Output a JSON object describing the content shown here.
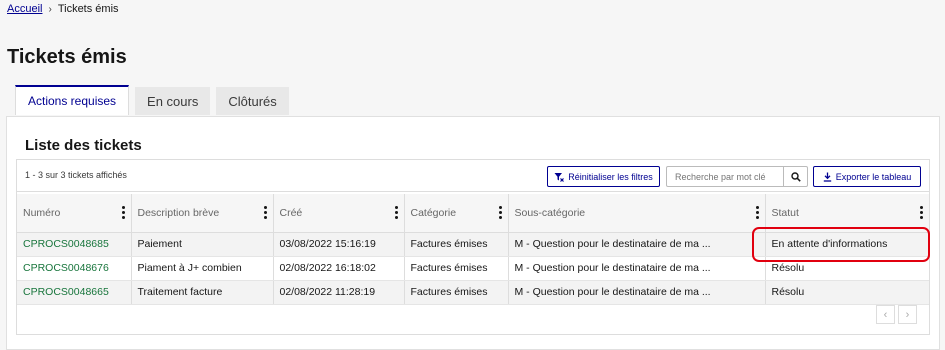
{
  "breadcrumb": {
    "home": "Accueil",
    "separator": "›",
    "current": "Tickets émis"
  },
  "page": {
    "title": "Tickets émis"
  },
  "tabs": [
    {
      "label": "Actions requises",
      "active": true
    },
    {
      "label": "En cours",
      "active": false
    },
    {
      "label": "Clôturés",
      "active": false
    }
  ],
  "list": {
    "title": "Liste des tickets",
    "count_text": "1 - 3 sur 3 tickets affichés",
    "reset_label": "Réinitialiser les filtres",
    "search_placeholder": "Recherche par mot clé",
    "export_label": "Exporter le tableau"
  },
  "table": {
    "headers": [
      "Numéro",
      "Description brève",
      "Créé",
      "Catégorie",
      "Sous-catégorie",
      "Statut"
    ],
    "rows": [
      [
        "CPROCS0048685",
        "Paiement",
        "03/08/2022 15:16:19",
        "Factures émises",
        "M - Question pour le destinataire de ma ...",
        "En attente d'informations"
      ],
      [
        "CPROCS0048676",
        "Piament à J+ combien",
        "02/08/2022 16:18:02",
        "Factures émises",
        "M - Question pour le destinataire de ma ...",
        "Résolu"
      ],
      [
        "CPROCS0048665",
        "Traitement facture",
        "02/08/2022 11:28:19",
        "Factures émises",
        "M - Question pour le destinataire de ma ...",
        "Résolu"
      ]
    ]
  },
  "pager": {
    "prev": "‹",
    "next": "›"
  },
  "colors": {
    "primary": "#000091",
    "link_green": "#18753c",
    "highlight": "#e1000f"
  }
}
